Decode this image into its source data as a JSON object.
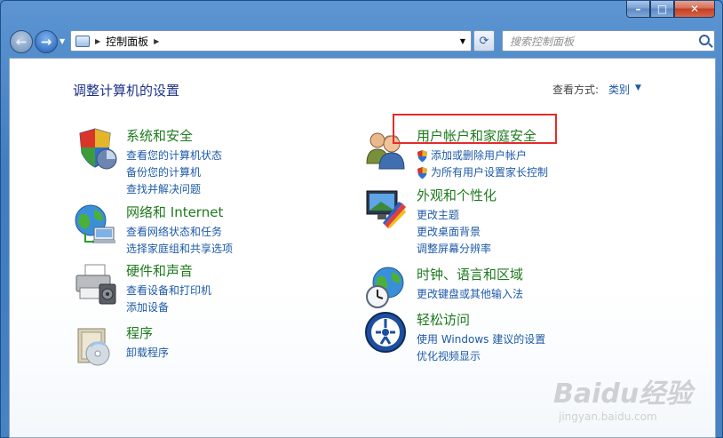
{
  "window": {
    "controls": {
      "minimize": "–",
      "maximize": "□",
      "close": "✕"
    }
  },
  "toolbar": {
    "back_glyph": "←",
    "forward_glyph": "→",
    "breadcrumb": "控制面板",
    "search_placeholder": "搜索控制面板",
    "refresh_glyph": "⟳"
  },
  "header": {
    "title": "调整计算机的设置",
    "view_by_label": "查看方式:",
    "view_by_value": "类别"
  },
  "categories": [
    {
      "title": "系统和安全",
      "icon": "shield-icon",
      "links": [
        "查看您的计算机状态",
        "备份您的计算机",
        "查找并解决问题"
      ]
    },
    {
      "title": "网络和 Internet",
      "icon": "network-globe-icon",
      "links": [
        "查看网络状态和任务",
        "选择家庭组和共享选项"
      ]
    },
    {
      "title": "硬件和声音",
      "icon": "printer-icon",
      "links": [
        "查看设备和打印机",
        "添加设备"
      ]
    },
    {
      "title": "程序",
      "icon": "programs-disc-icon",
      "links": [
        "卸载程序"
      ]
    },
    {
      "title": "用户帐户和家庭安全",
      "icon": "users-icon",
      "links": [
        "添加或删除用户帐户",
        "为所有用户设置家长控制"
      ]
    },
    {
      "title": "外观和个性化",
      "icon": "monitor-palette-icon",
      "links": [
        "更改主题",
        "更改桌面背景",
        "调整屏幕分辨率"
      ]
    },
    {
      "title": "时钟、语言和区域",
      "icon": "clock-globe-icon",
      "links": [
        "更改键盘或其他输入法"
      ]
    },
    {
      "title": "轻松访问",
      "icon": "accessibility-icon",
      "links": [
        "使用 Windows 建议的设置",
        "优化视频显示"
      ]
    }
  ],
  "watermark": {
    "main": "Baidu经验",
    "sub": "jingyan.baidu.com"
  },
  "colors": {
    "category_title": "#1e7a1e",
    "link": "#1e5aa8",
    "page_title": "#1e3287",
    "highlight": "#e52b2b"
  }
}
